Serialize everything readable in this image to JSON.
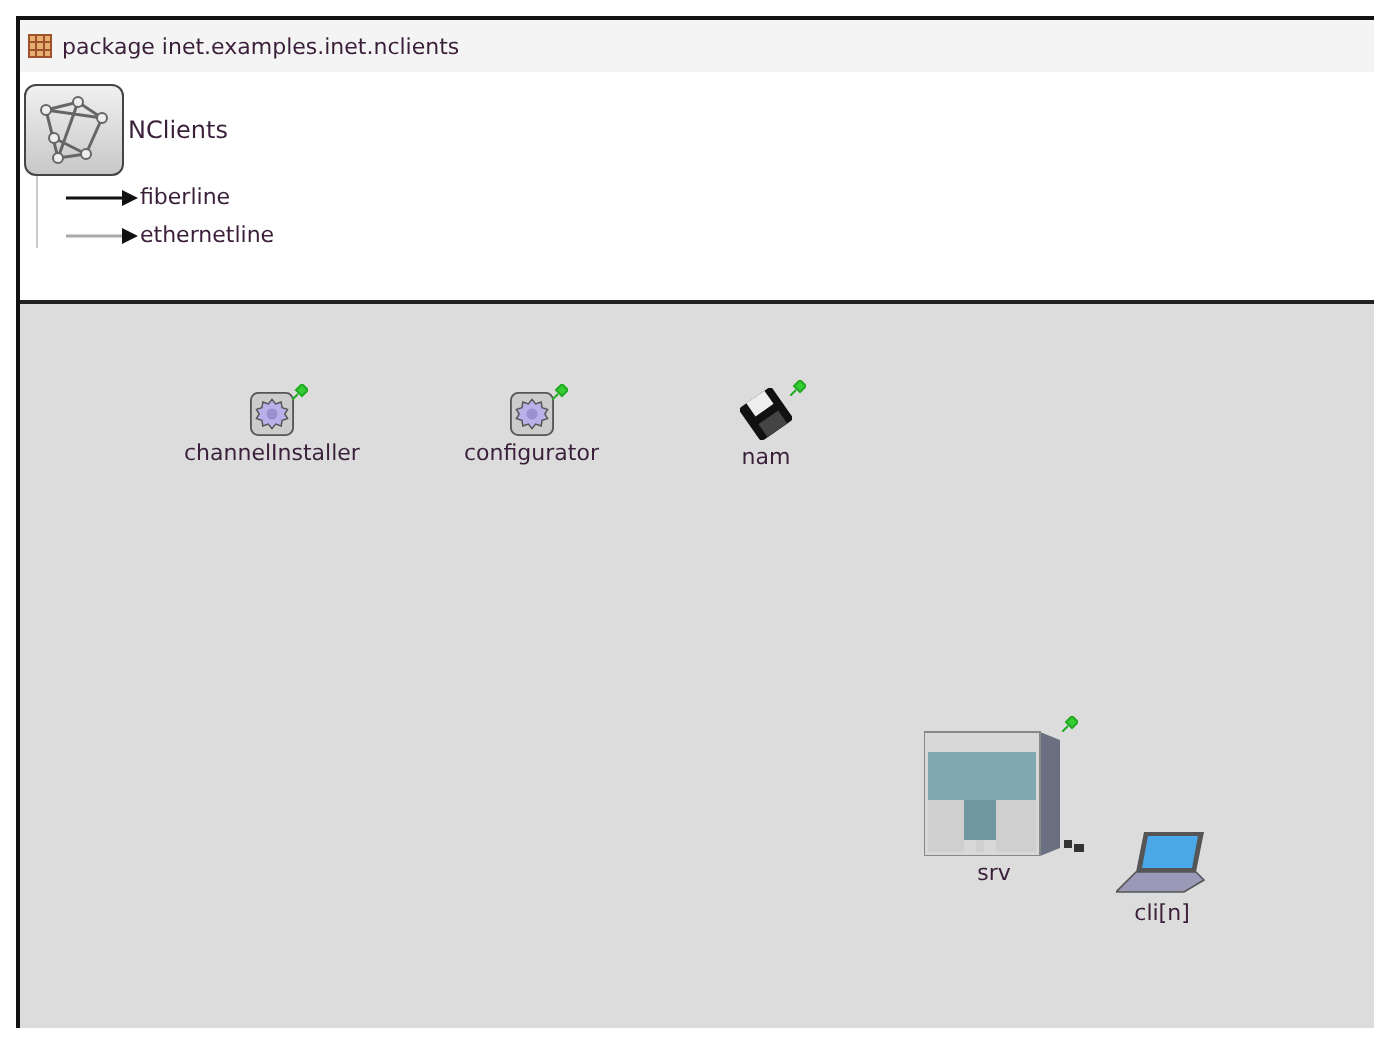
{
  "package": "package inet.examples.inet.nclients",
  "network": {
    "name": "NClients"
  },
  "channels": [
    {
      "label": "fiberline",
      "kind": "dark"
    },
    {
      "label": "ethernetline",
      "kind": "light"
    }
  ],
  "nodes": [
    {
      "label": "channelInstaller",
      "kind": "gear",
      "pinned": true
    },
    {
      "label": "configurator",
      "kind": "gear",
      "pinned": true
    },
    {
      "label": "nam",
      "kind": "floppy",
      "pinned": true
    },
    {
      "label": "srv",
      "kind": "server",
      "pinned": true
    },
    {
      "label": "cli[n]",
      "kind": "laptop",
      "pinned": false
    }
  ]
}
